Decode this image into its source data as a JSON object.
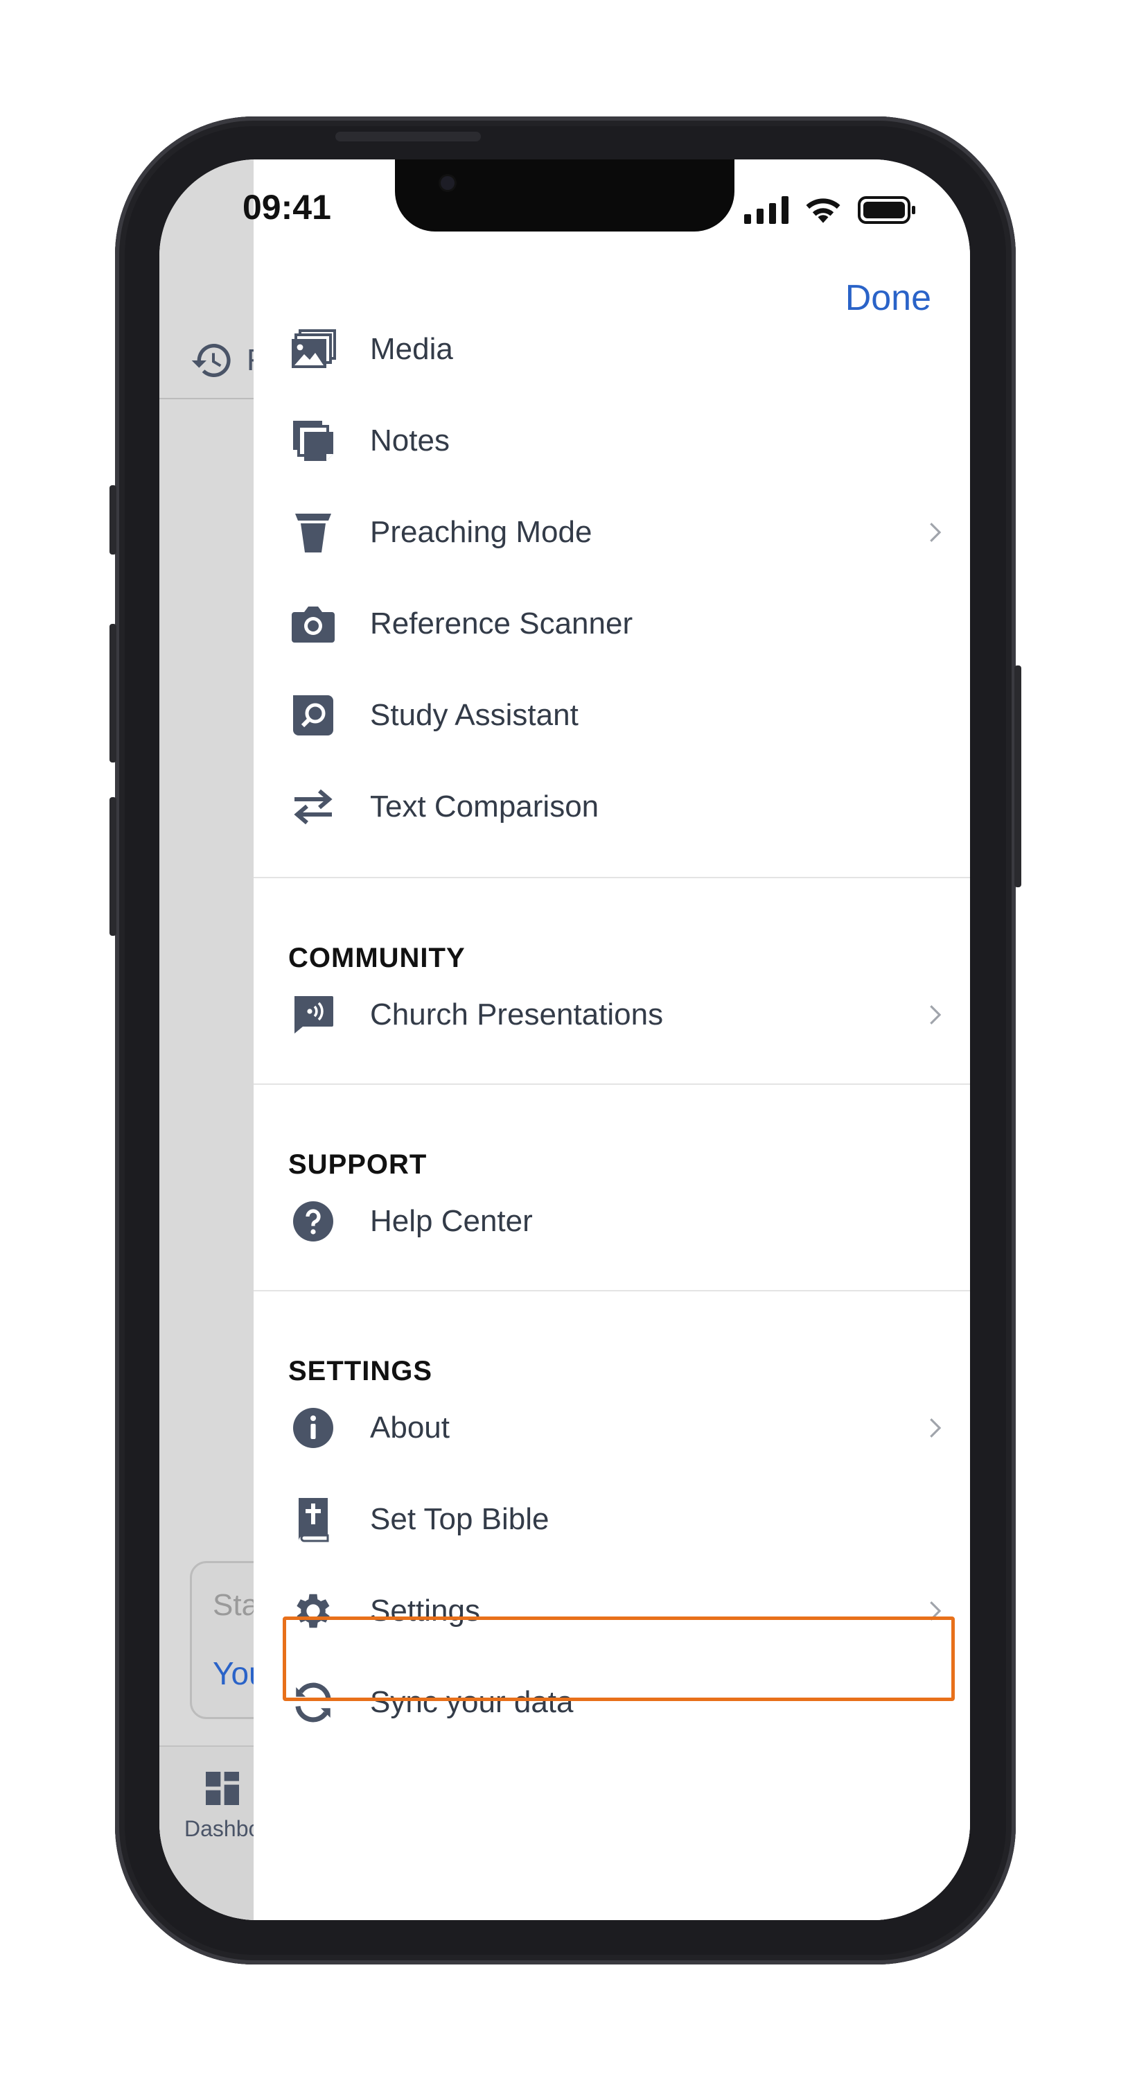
{
  "status": {
    "time": "09:41"
  },
  "header": {
    "done_label": "Done"
  },
  "menu": {
    "items_top": [
      {
        "label": "Media",
        "icon": "media-icon"
      },
      {
        "label": "Notes",
        "icon": "notes-icon"
      },
      {
        "label": "Preaching Mode",
        "icon": "pulpit-icon",
        "chevron": true
      },
      {
        "label": "Reference Scanner",
        "icon": "camera-icon"
      },
      {
        "label": "Study Assistant",
        "icon": "search-chat-icon"
      },
      {
        "label": "Text Comparison",
        "icon": "swap-arrows-icon"
      }
    ],
    "community": {
      "title": "COMMUNITY",
      "items": [
        {
          "label": "Church Presentations",
          "icon": "broadcast-chat-icon",
          "chevron": true
        }
      ]
    },
    "support": {
      "title": "SUPPORT",
      "items": [
        {
          "label": "Help Center",
          "icon": "help-icon"
        }
      ]
    },
    "settings": {
      "title": "SETTINGS",
      "items": [
        {
          "label": "About",
          "icon": "info-icon",
          "chevron": true
        },
        {
          "label": "Set Top Bible",
          "icon": "bible-icon"
        },
        {
          "label": "Settings",
          "icon": "gear-icon",
          "chevron": true,
          "highlighted": true
        },
        {
          "label": "Sync your data",
          "icon": "sync-icon"
        }
      ]
    }
  },
  "background_app": {
    "recent_label": "R",
    "card_placeholder": "Sta",
    "card_link": "You",
    "tab_label": "Dashbo"
  },
  "colors": {
    "accent": "#2a63c8",
    "highlight": "#e8701a",
    "icon": "#4a5467",
    "text": "#333b48"
  }
}
